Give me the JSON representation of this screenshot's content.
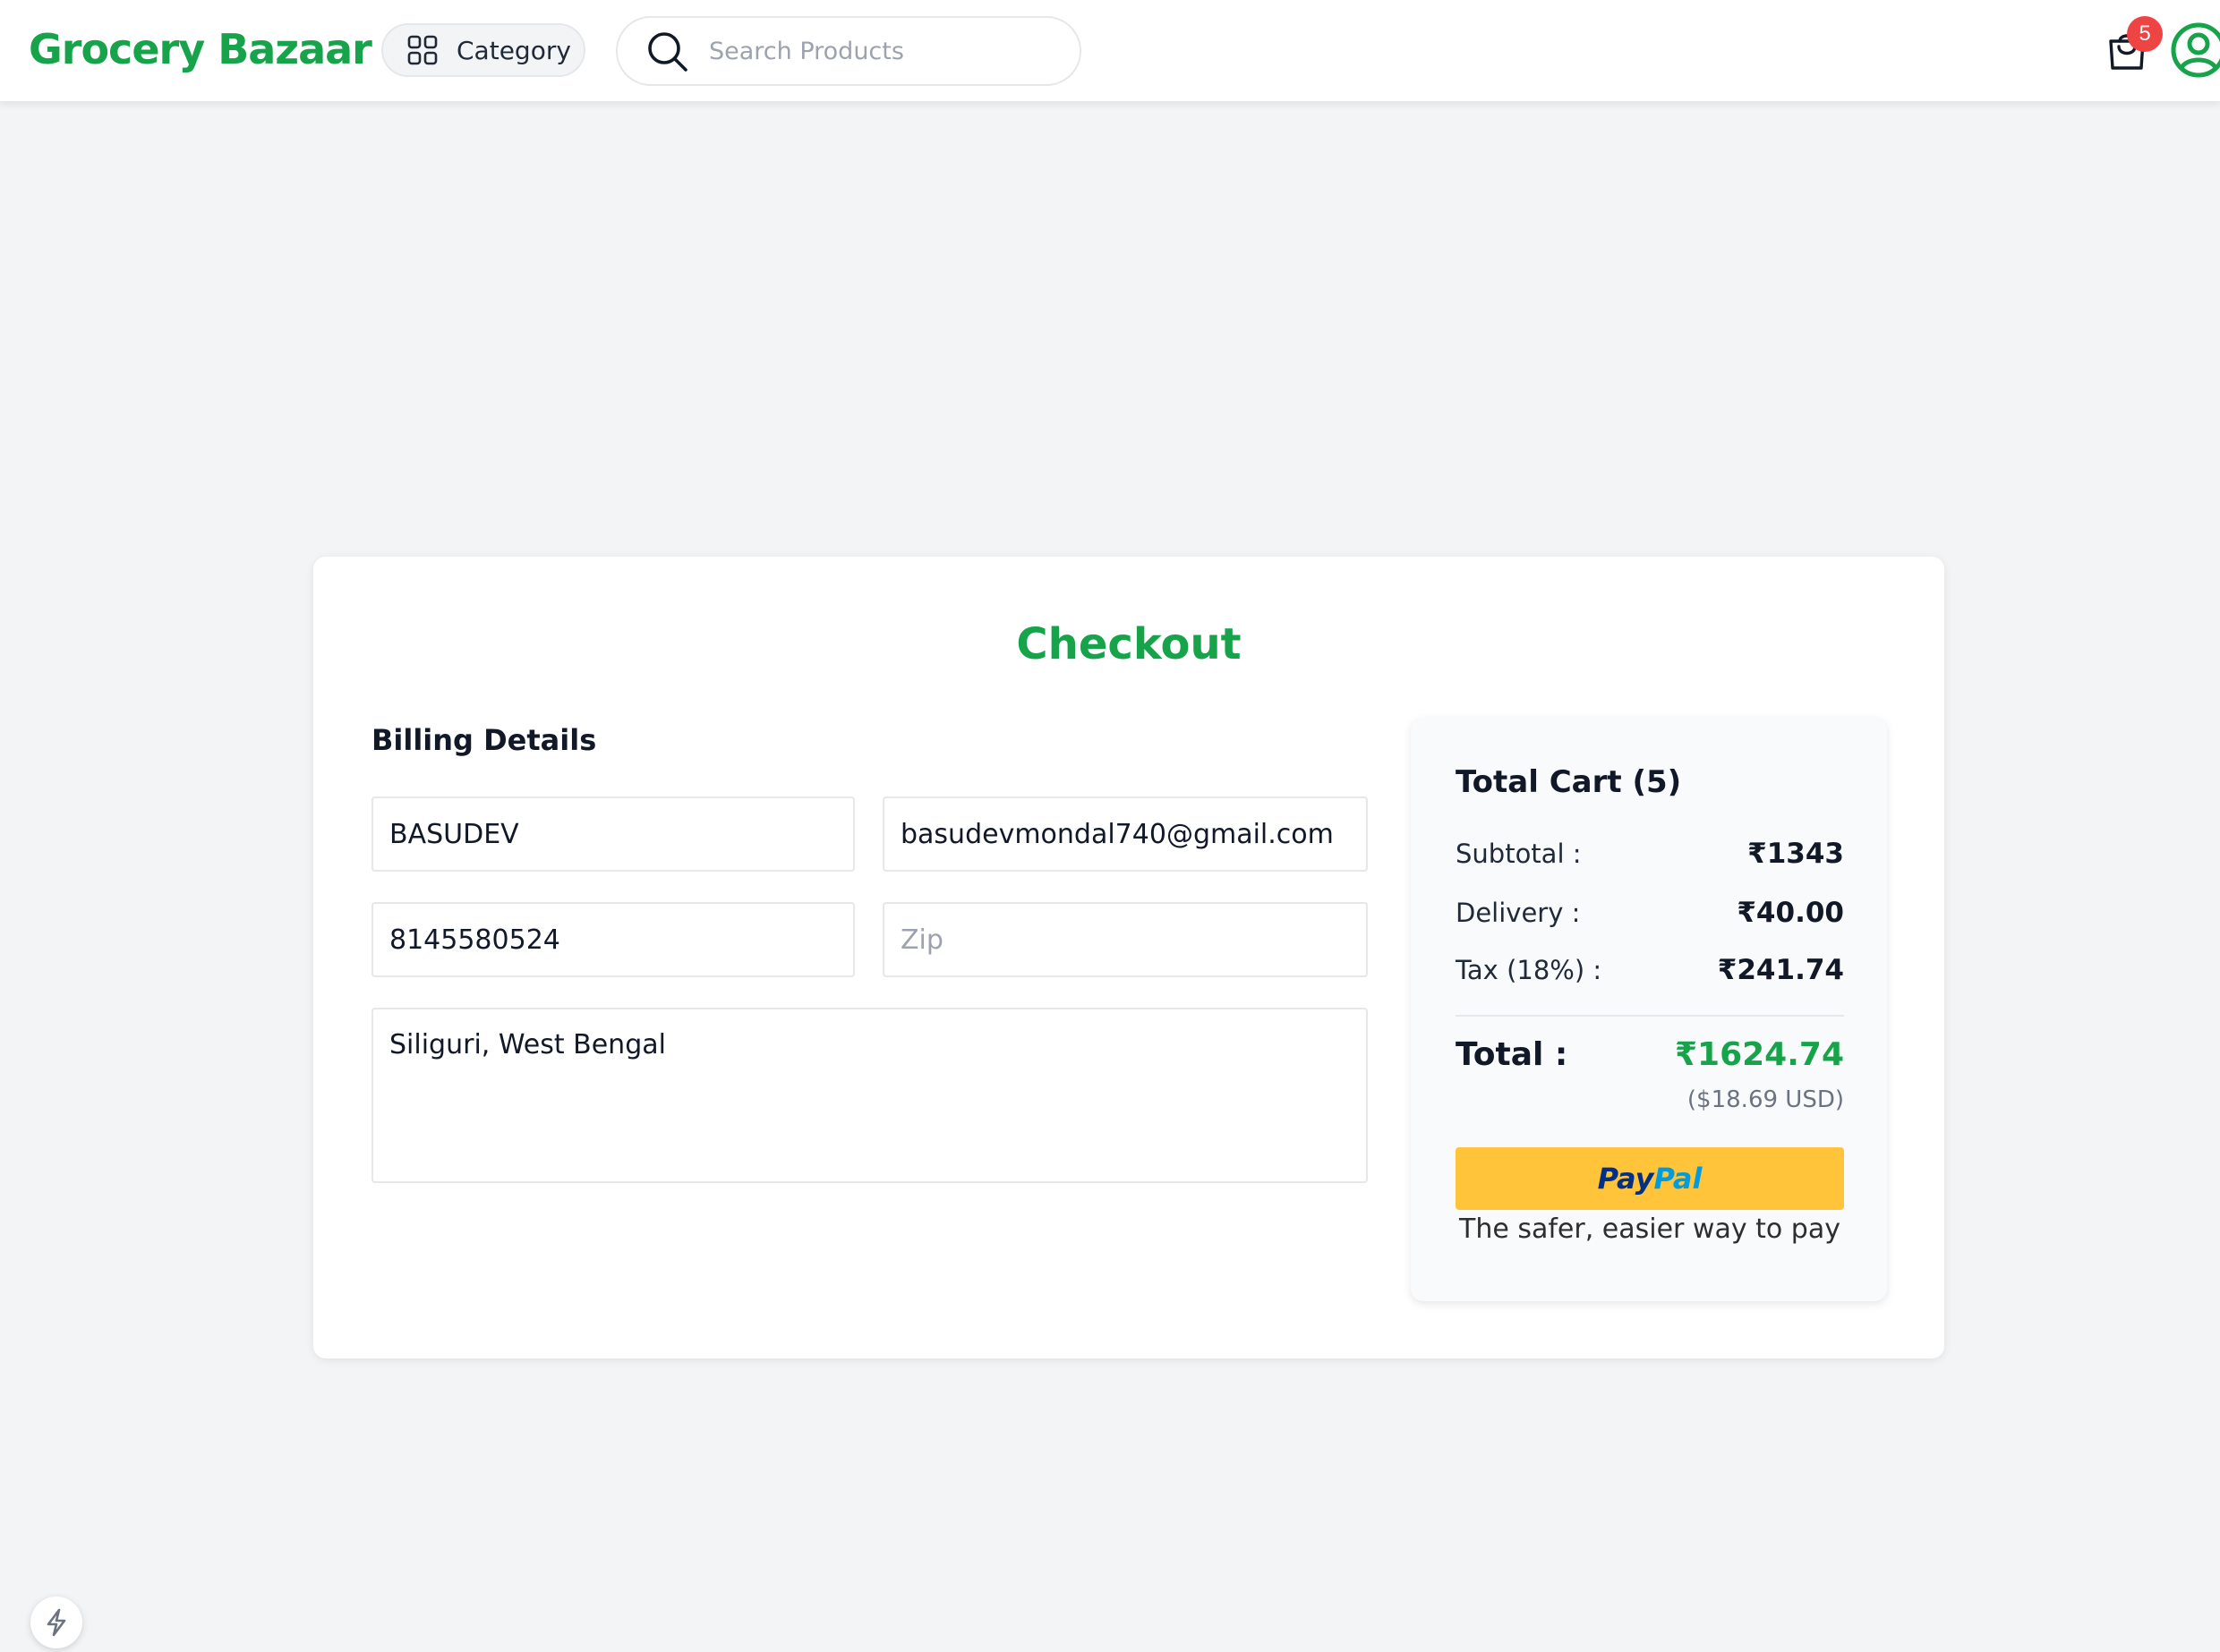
{
  "header": {
    "logo": "Grocery Bazaar",
    "category_label": "Category",
    "search_placeholder": "Search Products",
    "cart_count": "5"
  },
  "checkout": {
    "title": "Checkout",
    "billing_title": "Billing Details",
    "fields": {
      "name": "BASUDEV",
      "email": "basudevmondal740@gmail.com",
      "phone": "8145580524",
      "zip_placeholder": "Zip",
      "address": "Siliguri, West Bengal"
    }
  },
  "summary": {
    "title": "Total Cart (5)",
    "subtotal_label": "Subtotal :",
    "subtotal_value": "₹1343",
    "delivery_label": "Delivery :",
    "delivery_value": "₹40.00",
    "tax_label": "Tax (18%) :",
    "tax_value": "₹241.74",
    "total_label": "Total :",
    "total_value": "₹1624.74",
    "total_usd": "($18.69 USD)",
    "paypal_pay": "Pay",
    "paypal_pal": "Pal",
    "paypal_tagline": "The safer, easier way to pay"
  },
  "colors": {
    "brand": "#16a34a",
    "badge": "#ef4444",
    "paypal_yellow": "#ffc439",
    "paypal_navy": "#003087",
    "paypal_blue": "#009cde"
  },
  "icons": {
    "category": "grid-icon",
    "search": "search-icon",
    "cart": "shopping-bag-icon",
    "user": "user-circle-icon",
    "dev": "lightning-icon"
  }
}
